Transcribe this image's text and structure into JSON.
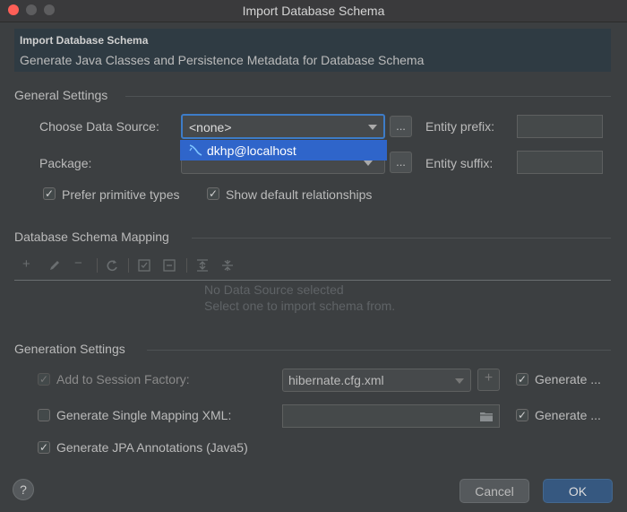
{
  "window": {
    "title": "Import Database Schema"
  },
  "header": {
    "title": "Import Database Schema",
    "description": "Generate Java Classes and Persistence Metadata for Database Schema"
  },
  "general": {
    "section_label": "General Settings",
    "data_source_label": "Choose Data Source:",
    "data_source_value": "<none>",
    "data_source_option": "dkhp@localhost",
    "browse_label": "...",
    "package_label": "Package:",
    "package_value": "",
    "entity_prefix_label": "Entity prefix:",
    "entity_suffix_label": "Entity suffix:",
    "prefer_primitive_label": "Prefer primitive types",
    "show_default_rel_label": "Show default relationships"
  },
  "mapping": {
    "section_label": "Database Schema Mapping",
    "empty_line1": "No Data Source selected",
    "empty_line2": "Select one to import schema from."
  },
  "generation": {
    "section_label": "Generation Settings",
    "add_session_label": "Add to Session Factory:",
    "session_file_value": "hibernate.cfg.xml",
    "generate1_label": "Generate ...",
    "single_mapping_label": "Generate Single Mapping XML:",
    "generate2_label": "Generate ...",
    "jpa_label": "Generate JPA Annotations (Java5)"
  },
  "footer": {
    "help_label": "?",
    "cancel_label": "Cancel",
    "ok_label": "OK"
  },
  "colors": {
    "accent": "#2f65ca",
    "ok_button": "#365880",
    "background": "#3c3f41"
  }
}
